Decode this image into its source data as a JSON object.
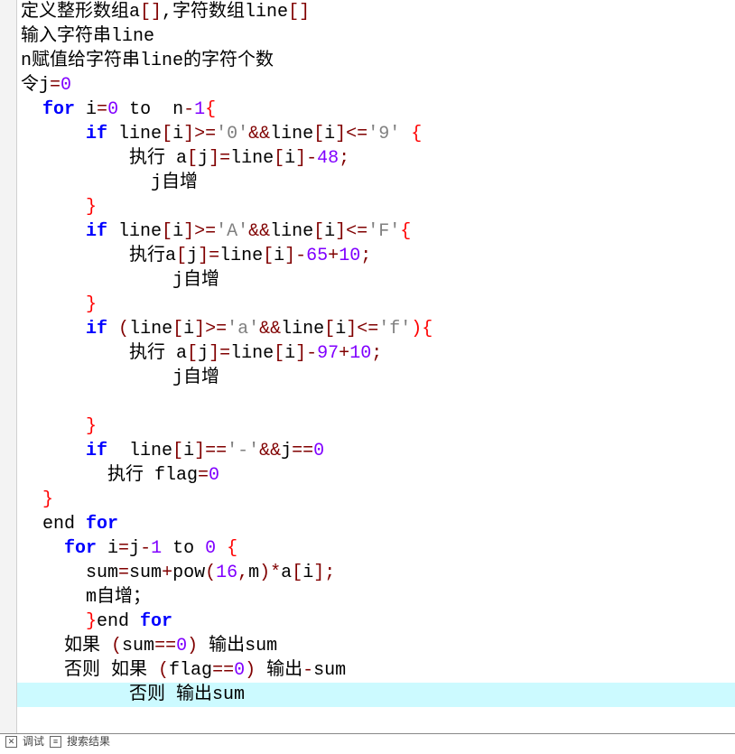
{
  "code": {
    "lines": [
      {
        "indent": 0,
        "hl": false,
        "tokens": [
          {
            "t": "定义整形数组a",
            "c": "black"
          },
          {
            "t": "[]",
            "c": "maroon"
          },
          {
            "t": ",",
            "c": "black"
          },
          {
            "t": "字符数组line",
            "c": "black"
          },
          {
            "t": "[]",
            "c": "maroon"
          }
        ]
      },
      {
        "indent": 0,
        "hl": false,
        "tokens": [
          {
            "t": "输入字符串line",
            "c": "black"
          }
        ]
      },
      {
        "indent": 0,
        "hl": false,
        "tokens": [
          {
            "t": "n赋值给字符串line的字符个数",
            "c": "black"
          }
        ]
      },
      {
        "indent": 0,
        "hl": false,
        "tokens": [
          {
            "t": "令j",
            "c": "black"
          },
          {
            "t": "=",
            "c": "maroon"
          },
          {
            "t": "0",
            "c": "purple"
          }
        ]
      },
      {
        "indent": 1,
        "hl": false,
        "tokens": [
          {
            "t": "for",
            "c": "blue",
            "b": true
          },
          {
            "t": " i",
            "c": "black"
          },
          {
            "t": "=",
            "c": "maroon"
          },
          {
            "t": "0",
            "c": "purple"
          },
          {
            "t": " to  n",
            "c": "black"
          },
          {
            "t": "-",
            "c": "maroon"
          },
          {
            "t": "1",
            "c": "purple"
          },
          {
            "t": "{",
            "c": "red"
          }
        ]
      },
      {
        "indent": 3,
        "hl": false,
        "tokens": [
          {
            "t": "if",
            "c": "blue",
            "b": true
          },
          {
            "t": " line",
            "c": "black"
          },
          {
            "t": "[",
            "c": "maroon"
          },
          {
            "t": "i",
            "c": "black"
          },
          {
            "t": "]>=",
            "c": "maroon"
          },
          {
            "t": "'0'",
            "c": "grey"
          },
          {
            "t": "&&",
            "c": "maroon"
          },
          {
            "t": "line",
            "c": "black"
          },
          {
            "t": "[",
            "c": "maroon"
          },
          {
            "t": "i",
            "c": "black"
          },
          {
            "t": "]<=",
            "c": "maroon"
          },
          {
            "t": "'9'",
            "c": "grey"
          },
          {
            "t": " ",
            "c": "black"
          },
          {
            "t": "{",
            "c": "red"
          }
        ]
      },
      {
        "indent": 5,
        "hl": false,
        "tokens": [
          {
            "t": "执行 a",
            "c": "black"
          },
          {
            "t": "[",
            "c": "maroon"
          },
          {
            "t": "j",
            "c": "black"
          },
          {
            "t": "]=",
            "c": "maroon"
          },
          {
            "t": "line",
            "c": "black"
          },
          {
            "t": "[",
            "c": "maroon"
          },
          {
            "t": "i",
            "c": "black"
          },
          {
            "t": "]-",
            "c": "maroon"
          },
          {
            "t": "48",
            "c": "purple"
          },
          {
            "t": ";",
            "c": "maroon"
          }
        ]
      },
      {
        "indent": 6,
        "hl": false,
        "tokens": [
          {
            "t": "j自增",
            "c": "black"
          }
        ]
      },
      {
        "indent": 3,
        "hl": false,
        "tokens": [
          {
            "t": "}",
            "c": "red"
          }
        ]
      },
      {
        "indent": 3,
        "hl": false,
        "tokens": [
          {
            "t": "if",
            "c": "blue",
            "b": true
          },
          {
            "t": " line",
            "c": "black"
          },
          {
            "t": "[",
            "c": "maroon"
          },
          {
            "t": "i",
            "c": "black"
          },
          {
            "t": "]>=",
            "c": "maroon"
          },
          {
            "t": "'A'",
            "c": "grey"
          },
          {
            "t": "&&",
            "c": "maroon"
          },
          {
            "t": "line",
            "c": "black"
          },
          {
            "t": "[",
            "c": "maroon"
          },
          {
            "t": "i",
            "c": "black"
          },
          {
            "t": "]<=",
            "c": "maroon"
          },
          {
            "t": "'F'",
            "c": "grey"
          },
          {
            "t": "{",
            "c": "red"
          }
        ]
      },
      {
        "indent": 5,
        "hl": false,
        "tokens": [
          {
            "t": "执行a",
            "c": "black"
          },
          {
            "t": "[",
            "c": "maroon"
          },
          {
            "t": "j",
            "c": "black"
          },
          {
            "t": "]=",
            "c": "maroon"
          },
          {
            "t": "line",
            "c": "black"
          },
          {
            "t": "[",
            "c": "maroon"
          },
          {
            "t": "i",
            "c": "black"
          },
          {
            "t": "]-",
            "c": "maroon"
          },
          {
            "t": "65",
            "c": "purple"
          },
          {
            "t": "+",
            "c": "maroon"
          },
          {
            "t": "10",
            "c": "purple"
          },
          {
            "t": ";",
            "c": "maroon"
          }
        ]
      },
      {
        "indent": 7,
        "hl": false,
        "tokens": [
          {
            "t": "j自增",
            "c": "black"
          }
        ]
      },
      {
        "indent": 3,
        "hl": false,
        "tokens": [
          {
            "t": "}",
            "c": "red"
          }
        ]
      },
      {
        "indent": 3,
        "hl": false,
        "tokens": [
          {
            "t": "if",
            "c": "blue",
            "b": true
          },
          {
            "t": " ",
            "c": "black"
          },
          {
            "t": "(",
            "c": "maroon"
          },
          {
            "t": "line",
            "c": "black"
          },
          {
            "t": "[",
            "c": "maroon"
          },
          {
            "t": "i",
            "c": "black"
          },
          {
            "t": "]>=",
            "c": "maroon"
          },
          {
            "t": "'a'",
            "c": "grey"
          },
          {
            "t": "&&",
            "c": "maroon"
          },
          {
            "t": "line",
            "c": "black"
          },
          {
            "t": "[",
            "c": "maroon"
          },
          {
            "t": "i",
            "c": "black"
          },
          {
            "t": "]<=",
            "c": "maroon"
          },
          {
            "t": "'f'",
            "c": "grey"
          },
          {
            "t": "){",
            "c": "red"
          }
        ]
      },
      {
        "indent": 5,
        "hl": false,
        "tokens": [
          {
            "t": "执行 a",
            "c": "black"
          },
          {
            "t": "[",
            "c": "maroon"
          },
          {
            "t": "j",
            "c": "black"
          },
          {
            "t": "]=",
            "c": "maroon"
          },
          {
            "t": "line",
            "c": "black"
          },
          {
            "t": "[",
            "c": "maroon"
          },
          {
            "t": "i",
            "c": "black"
          },
          {
            "t": "]-",
            "c": "maroon"
          },
          {
            "t": "97",
            "c": "purple"
          },
          {
            "t": "+",
            "c": "maroon"
          },
          {
            "t": "10",
            "c": "purple"
          },
          {
            "t": ";",
            "c": "maroon"
          }
        ]
      },
      {
        "indent": 7,
        "hl": false,
        "tokens": [
          {
            "t": "j自增",
            "c": "black"
          }
        ]
      },
      {
        "indent": 0,
        "hl": false,
        "tokens": [
          {
            "t": "",
            "c": "black"
          }
        ]
      },
      {
        "indent": 3,
        "hl": false,
        "tokens": [
          {
            "t": "}",
            "c": "red"
          }
        ]
      },
      {
        "indent": 3,
        "hl": false,
        "tokens": [
          {
            "t": "if",
            "c": "blue",
            "b": true
          },
          {
            "t": "  line",
            "c": "black"
          },
          {
            "t": "[",
            "c": "maroon"
          },
          {
            "t": "i",
            "c": "black"
          },
          {
            "t": "]==",
            "c": "maroon"
          },
          {
            "t": "'-'",
            "c": "grey"
          },
          {
            "t": "&&",
            "c": "maroon"
          },
          {
            "t": "j",
            "c": "black"
          },
          {
            "t": "==",
            "c": "maroon"
          },
          {
            "t": "0",
            "c": "purple"
          }
        ]
      },
      {
        "indent": 4,
        "hl": false,
        "tokens": [
          {
            "t": "执行 flag",
            "c": "black"
          },
          {
            "t": "=",
            "c": "maroon"
          },
          {
            "t": "0",
            "c": "purple"
          }
        ]
      },
      {
        "indent": 1,
        "hl": false,
        "tokens": [
          {
            "t": "}",
            "c": "red"
          }
        ]
      },
      {
        "indent": 1,
        "hl": false,
        "tokens": [
          {
            "t": "end ",
            "c": "black"
          },
          {
            "t": "for",
            "c": "blue",
            "b": true
          }
        ]
      },
      {
        "indent": 2,
        "hl": false,
        "tokens": [
          {
            "t": "for",
            "c": "blue",
            "b": true
          },
          {
            "t": " i",
            "c": "black"
          },
          {
            "t": "=",
            "c": "maroon"
          },
          {
            "t": "j",
            "c": "black"
          },
          {
            "t": "-",
            "c": "maroon"
          },
          {
            "t": "1",
            "c": "purple"
          },
          {
            "t": " to ",
            "c": "black"
          },
          {
            "t": "0",
            "c": "purple"
          },
          {
            "t": " ",
            "c": "black"
          },
          {
            "t": "{",
            "c": "red"
          }
        ]
      },
      {
        "indent": 3,
        "hl": false,
        "tokens": [
          {
            "t": "sum",
            "c": "black"
          },
          {
            "t": "=",
            "c": "maroon"
          },
          {
            "t": "sum",
            "c": "black"
          },
          {
            "t": "+",
            "c": "maroon"
          },
          {
            "t": "pow",
            "c": "black"
          },
          {
            "t": "(",
            "c": "maroon"
          },
          {
            "t": "16",
            "c": "purple"
          },
          {
            "t": ",",
            "c": "maroon"
          },
          {
            "t": "m",
            "c": "black"
          },
          {
            "t": ")*",
            "c": "maroon"
          },
          {
            "t": "a",
            "c": "black"
          },
          {
            "t": "[",
            "c": "maroon"
          },
          {
            "t": "i",
            "c": "black"
          },
          {
            "t": "];",
            "c": "maroon"
          }
        ]
      },
      {
        "indent": 3,
        "hl": false,
        "tokens": [
          {
            "t": "m自增；",
            "c": "black"
          }
        ]
      },
      {
        "indent": 3,
        "hl": false,
        "tokens": [
          {
            "t": "}",
            "c": "red"
          },
          {
            "t": "end ",
            "c": "black"
          },
          {
            "t": "for",
            "c": "blue",
            "b": true
          }
        ]
      },
      {
        "indent": 2,
        "hl": false,
        "tokens": [
          {
            "t": "如果 ",
            "c": "black"
          },
          {
            "t": "(",
            "c": "maroon"
          },
          {
            "t": "sum",
            "c": "black"
          },
          {
            "t": "==",
            "c": "maroon"
          },
          {
            "t": "0",
            "c": "purple"
          },
          {
            "t": ")",
            "c": "maroon"
          },
          {
            "t": " 输出sum",
            "c": "black"
          }
        ]
      },
      {
        "indent": 2,
        "hl": false,
        "tokens": [
          {
            "t": "否则 如果 ",
            "c": "black"
          },
          {
            "t": "(",
            "c": "maroon"
          },
          {
            "t": "flag",
            "c": "black"
          },
          {
            "t": "==",
            "c": "maroon"
          },
          {
            "t": "0",
            "c": "purple"
          },
          {
            "t": ")",
            "c": "maroon"
          },
          {
            "t": " 输出",
            "c": "black"
          },
          {
            "t": "-",
            "c": "maroon"
          },
          {
            "t": "sum",
            "c": "black"
          }
        ]
      },
      {
        "indent": 5,
        "hl": true,
        "tokens": [
          {
            "t": "否则 输出sum",
            "c": "black"
          }
        ]
      }
    ]
  },
  "tabbar": {
    "tab1": "调试",
    "tab2": "搜索结果"
  }
}
